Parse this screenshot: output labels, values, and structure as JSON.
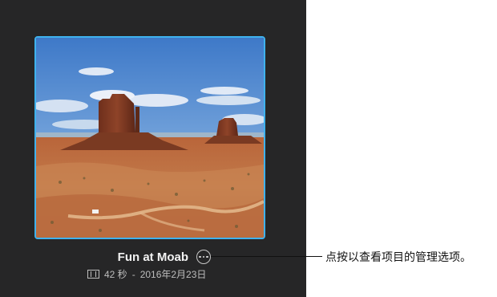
{
  "project": {
    "title": "Fun at Moab",
    "duration": "42 秒",
    "separator": "-",
    "date": "2016年2月23日",
    "thumbnail_icon": "film-icon",
    "more_icon": "ellipsis-circle-icon"
  },
  "callout": {
    "text": "点按以查看项目的管理选项。"
  },
  "colors": {
    "panel_bg": "#262627",
    "selection_border": "#3fb2ee",
    "title_text": "#f2f2f2",
    "meta_text": "#bdbdbd"
  }
}
